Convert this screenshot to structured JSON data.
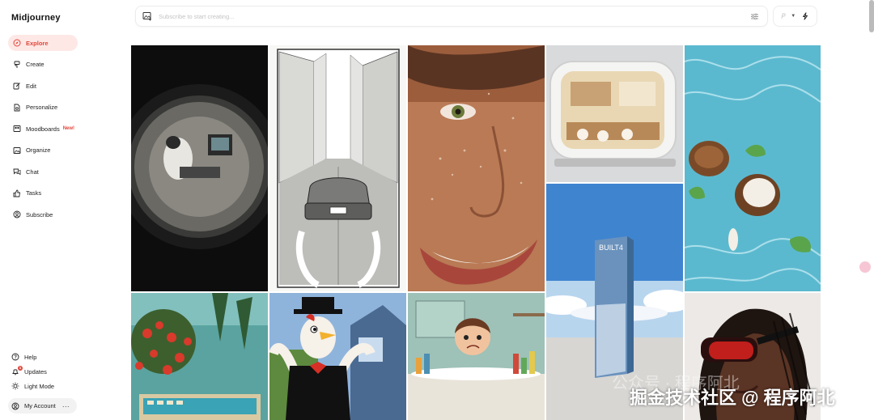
{
  "app": {
    "brand": "Midjourney"
  },
  "nav": {
    "items": [
      {
        "label": "Explore",
        "icon": "compass-icon",
        "active": true
      },
      {
        "label": "Create",
        "icon": "brush-icon"
      },
      {
        "label": "Edit",
        "icon": "edit-icon"
      },
      {
        "label": "Personalize",
        "icon": "personalize-icon"
      },
      {
        "label": "Moodboards",
        "icon": "moodboard-icon",
        "badge": "New!"
      },
      {
        "label": "Organize",
        "icon": "image-icon"
      },
      {
        "label": "Chat",
        "icon": "chat-icon"
      },
      {
        "label": "Tasks",
        "icon": "thumbs-up-icon"
      },
      {
        "label": "Subscribe",
        "icon": "person-circle-icon"
      }
    ]
  },
  "bottom_nav": {
    "help": "Help",
    "updates": "Updates",
    "updates_count": "1",
    "light_mode": "Light Mode",
    "account": "My Account",
    "account_more": "···"
  },
  "search": {
    "placeholder": "Subscribe to start creating..."
  },
  "gallery": {
    "tiles": [
      {
        "subject": "fisheye cow at computer"
      },
      {
        "subject": "sketch car city street"
      },
      {
        "subject": "closeup smiling face water drops"
      },
      {
        "subject": "miniature cafe capsule"
      },
      {
        "subject": "coconut in pool water"
      },
      {
        "subject": "monolith in desert sky",
        "text": "BUILT4"
      },
      {
        "subject": "tropical flowers vintage synth"
      },
      {
        "subject": "cartoon rooster tuxedo"
      },
      {
        "subject": "cartoon girl in bathtub"
      },
      {
        "subject": "woman red sunglasses braids"
      }
    ]
  },
  "watermark": {
    "text": "掘金技术社区 @ 程序阿北",
    "ghost": "公众号 · 程序阿北"
  },
  "colors": {
    "accent": "#e0473b",
    "accent_bg": "#fde8e6"
  }
}
